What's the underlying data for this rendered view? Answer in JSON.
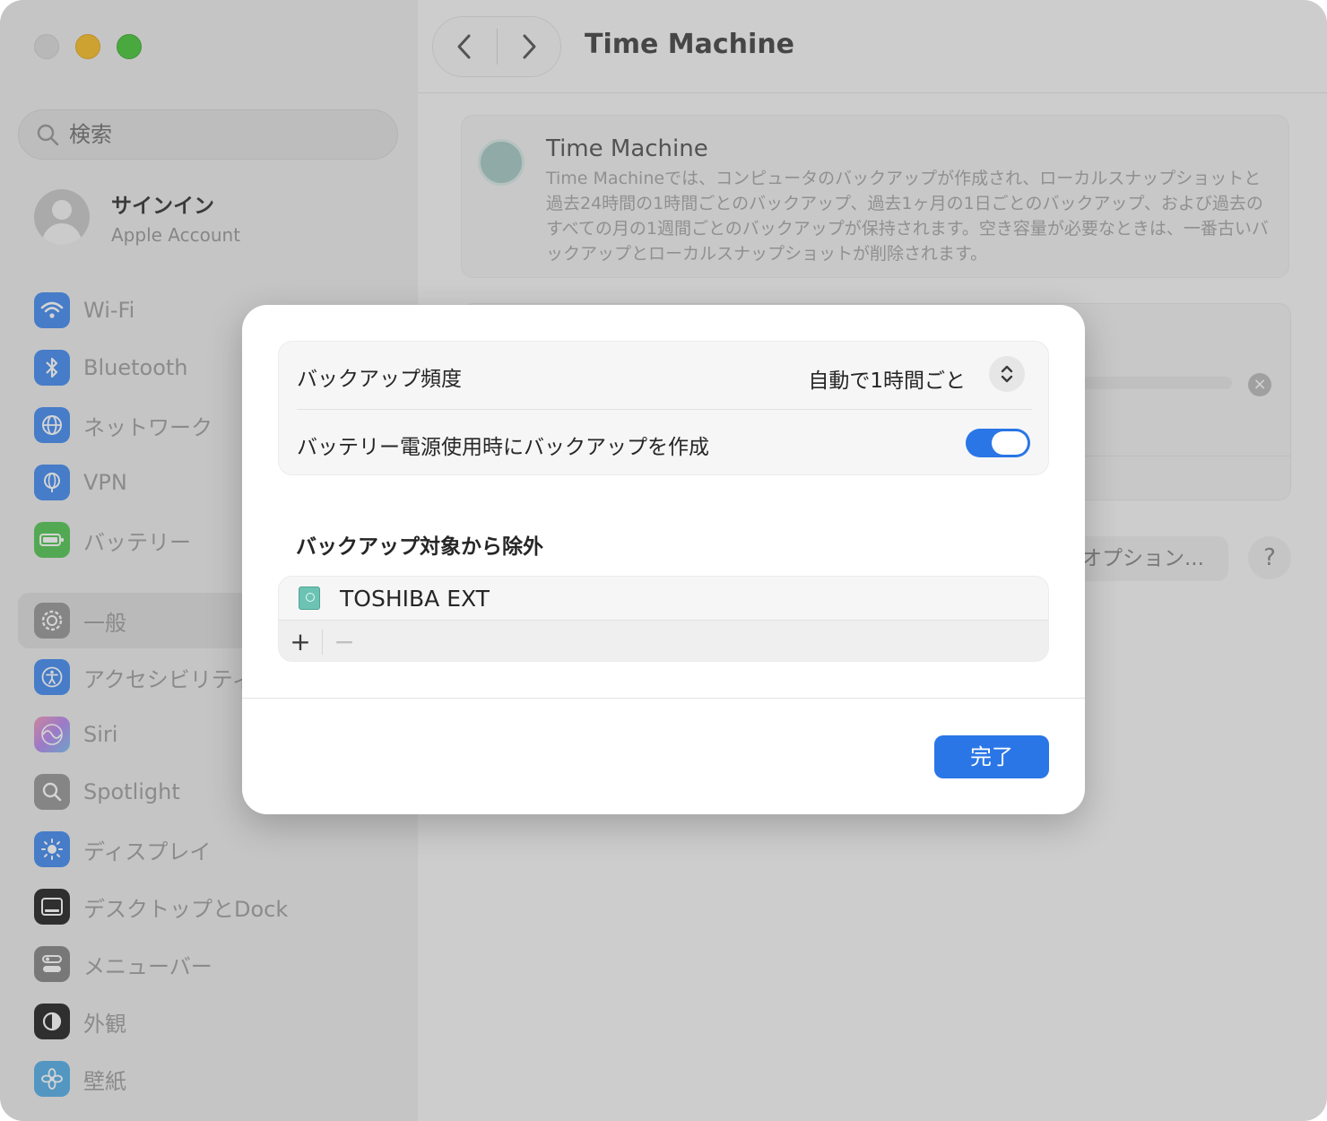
{
  "sidebar": {
    "search_placeholder": "検索",
    "account": {
      "title": "サインイン",
      "subtitle": "Apple Account"
    },
    "items": [
      {
        "label": "Wi-Fi",
        "icon": "wifi-icon",
        "color": "#4a8ff0"
      },
      {
        "label": "Bluetooth",
        "icon": "bluetooth-icon",
        "color": "#4a8ff0"
      },
      {
        "label": "ネットワーク",
        "icon": "globe-icon",
        "color": "#4a8ff0"
      },
      {
        "label": "VPN",
        "icon": "vpn-globe-icon",
        "color": "#4a8ff0"
      },
      {
        "label": "バッテリー",
        "icon": "battery-icon",
        "color": "#5ac85a"
      },
      {
        "label": "一般",
        "icon": "gear-icon",
        "color": "#9a9a9a"
      },
      {
        "label": "アクセシビリティ",
        "icon": "accessibility-icon",
        "color": "#4a8ff0"
      },
      {
        "label": "Siri",
        "icon": "siri-icon",
        "color": "#d27bd6"
      },
      {
        "label": "Spotlight",
        "icon": "magnifier-icon",
        "color": "#9a9a9a"
      },
      {
        "label": "ディスプレイ",
        "icon": "sun-icon",
        "color": "#4a8ff0"
      },
      {
        "label": "デスクトップとDock",
        "icon": "dock-icon",
        "color": "#2c2c2c"
      },
      {
        "label": "メニューバー",
        "icon": "menubar-icon",
        "color": "#8a8a8a"
      },
      {
        "label": "外観",
        "icon": "appearance-icon",
        "color": "#2c2c2c"
      },
      {
        "label": "壁紙",
        "icon": "flower-icon",
        "color": "#5ab0e8"
      }
    ]
  },
  "main": {
    "title": "Time Machine",
    "card": {
      "title": "Time Machine",
      "description": "Time Machineでは、コンピュータのバックアップが作成され、ローカルスナップショットと過去24時間の1時間ごとのバックアップ、過去1ヶ月の1日ごとのバックアップ、および過去のすべての月の1週間ごとのバックアップが保持されます。空き容量が必要なときは、一番古いバックアップとローカルスナップショットが削除されます。"
    },
    "options_label": "オプション...",
    "help_label": "?"
  },
  "modal": {
    "frequency_label": "バックアップ頻度",
    "frequency_value": "自動で1時間ごと",
    "battery_label": "バッテリー電源使用時にバックアップを作成",
    "battery_toggle_on": true,
    "exclusions_heading": "バックアップ対象から除外",
    "exclusions": [
      {
        "name": "TOSHIBA EXT",
        "icon": "external-drive-icon"
      }
    ],
    "add_label": "+",
    "remove_label": "−",
    "done_label": "完了"
  },
  "colors": {
    "accent": "#2a76e6"
  }
}
